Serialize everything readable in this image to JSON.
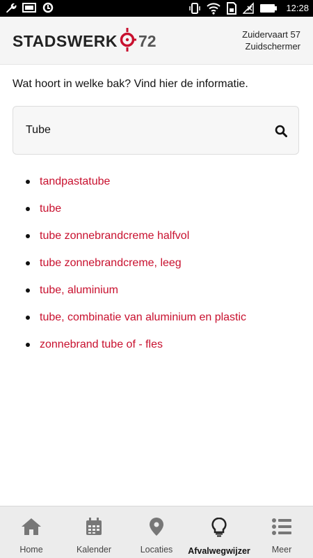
{
  "status_bar": {
    "time": "12:28",
    "icons": [
      "wrench-icon",
      "image-icon",
      "sync-icon",
      "vibrate-icon",
      "wifi-icon",
      "sim-icon",
      "no-signal-icon",
      "battery-icon"
    ]
  },
  "header": {
    "logo_text": "STADSWERK",
    "logo_number": "72",
    "address_line1": "Zuidervaart 57",
    "address_line2": "Zuidschermer",
    "colors": {
      "brand_red": "#c8102e"
    }
  },
  "main": {
    "intro": "Wat hoort in welke bak? Vind hier de informatie.",
    "search": {
      "value": "Tube",
      "icon": "search-icon"
    },
    "results": [
      "tandpastatube",
      "tube",
      "tube zonnebrandcreme halfvol",
      "tube zonnebrandcreme, leeg",
      "tube, aluminium",
      "tube, combinatie van aluminium en plastic",
      "zonnebrand tube of - fles"
    ]
  },
  "nav": {
    "items": [
      {
        "label": "Home",
        "icon": "home-icon"
      },
      {
        "label": "Kalender",
        "icon": "calendar-icon"
      },
      {
        "label": "Locaties",
        "icon": "location-pin-icon"
      },
      {
        "label": "Afvalwegwijzer",
        "icon": "lightbulb-icon",
        "active": true
      },
      {
        "label": "Meer",
        "icon": "menu-list-icon"
      }
    ]
  }
}
